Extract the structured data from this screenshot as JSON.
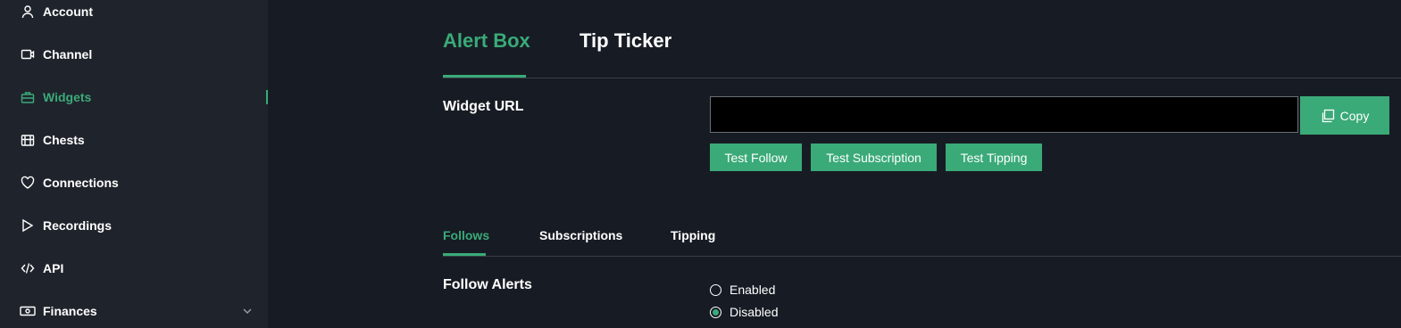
{
  "sidebar": {
    "items": [
      {
        "label": "Account",
        "icon": "user-icon"
      },
      {
        "label": "Channel",
        "icon": "video-icon"
      },
      {
        "label": "Widgets",
        "icon": "toolbox-icon"
      },
      {
        "label": "Chests",
        "icon": "chest-icon"
      },
      {
        "label": "Connections",
        "icon": "heart-icon"
      },
      {
        "label": "Recordings",
        "icon": "play-icon"
      },
      {
        "label": "API",
        "icon": "code-icon"
      },
      {
        "label": "Finances",
        "icon": "money-icon"
      }
    ],
    "active_item": "Widgets"
  },
  "top_tabs": [
    {
      "label": "Alert Box",
      "active": true
    },
    {
      "label": "Tip Ticker",
      "active": false
    }
  ],
  "widget_url": {
    "label": "Widget URL",
    "value": "",
    "copy_label": "Copy"
  },
  "test_buttons": [
    "Test Follow",
    "Test Subscription",
    "Test Tipping"
  ],
  "sub_tabs": [
    {
      "label": "Follows",
      "active": true
    },
    {
      "label": "Subscriptions",
      "active": false
    },
    {
      "label": "Tipping",
      "active": false
    }
  ],
  "follow_alerts": {
    "label": "Follow Alerts",
    "options": [
      {
        "label": "Enabled",
        "checked": false
      },
      {
        "label": "Disabled",
        "checked": true
      }
    ]
  },
  "colors": {
    "accent": "#3aaa78",
    "background": "#171c24",
    "sidebar_bg": "#1f242c"
  }
}
